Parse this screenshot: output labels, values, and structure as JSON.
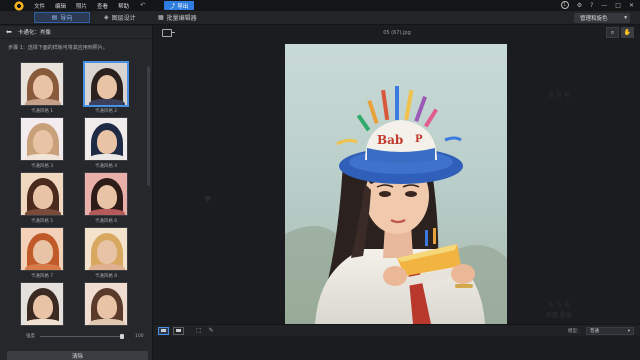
{
  "titlebar": {
    "menu": [
      "文件",
      "编辑",
      "照片",
      "查看",
      "帮助"
    ],
    "export_label": "导出",
    "notification_count": "1"
  },
  "tabbar": {
    "guide_label": "导向",
    "layers_label": "图层设计",
    "batch_label": "批量编辑器",
    "mode_label": "管理和旋色"
  },
  "left_panel": {
    "title": "卡通化：肖像",
    "step_text": "步骤 1：选择下面的样板可将其应用到照片。",
    "styles": [
      {
        "label": "卡通风格 1",
        "hair": "#8a5a3c",
        "body": "#c6a18a",
        "bg": "#e8e2da",
        "selected": false
      },
      {
        "label": "卡通风格 2",
        "hair": "#2a201d",
        "body": "#3a3f5a",
        "bg": "#d9d4d0",
        "selected": true
      },
      {
        "label": "卡通风格 3",
        "hair": "#c8a07a",
        "body": "#f1e4d8",
        "bg": "#f3ecee",
        "selected": false
      },
      {
        "label": "卡通风格 4",
        "hair": "#1f2a44",
        "body": "#ece8e8",
        "bg": "#f0eceb",
        "selected": false
      },
      {
        "label": "卡通风格 5",
        "hair": "#4a2a1c",
        "body": "#7a4a3a",
        "bg": "#f0d8c0",
        "selected": false
      },
      {
        "label": "卡通风格 6",
        "hair": "#2e1c18",
        "body": "#b45a5a",
        "bg": "#e8b0a8",
        "selected": false
      },
      {
        "label": "卡通风格 7",
        "hair": "#c05a28",
        "body": "#d87a4a",
        "bg": "#f3d0b8",
        "selected": false
      },
      {
        "label": "卡通风格 8",
        "hair": "#d8a860",
        "body": "#e0b090",
        "bg": "#f3e2cc",
        "selected": false
      },
      {
        "label": "",
        "hair": "#3a2a22",
        "body": "#f0e0d0",
        "bg": "#e4e0dc",
        "selected": false
      },
      {
        "label": "",
        "hair": "#5a3a2a",
        "body": "#e0c8b0",
        "bg": "#f0dcd0",
        "selected": false
      }
    ],
    "strength_label": "强度",
    "strength_value": "100",
    "strength_fraction": 1.0,
    "apply_label": "清除"
  },
  "main": {
    "filename": "05 (67).jpg",
    "watermark_lines": [
      "东 方 号",
      "东 方 号",
      "凤凰 数据"
    ],
    "blend_label": "模型：",
    "blend_value": "普通"
  }
}
